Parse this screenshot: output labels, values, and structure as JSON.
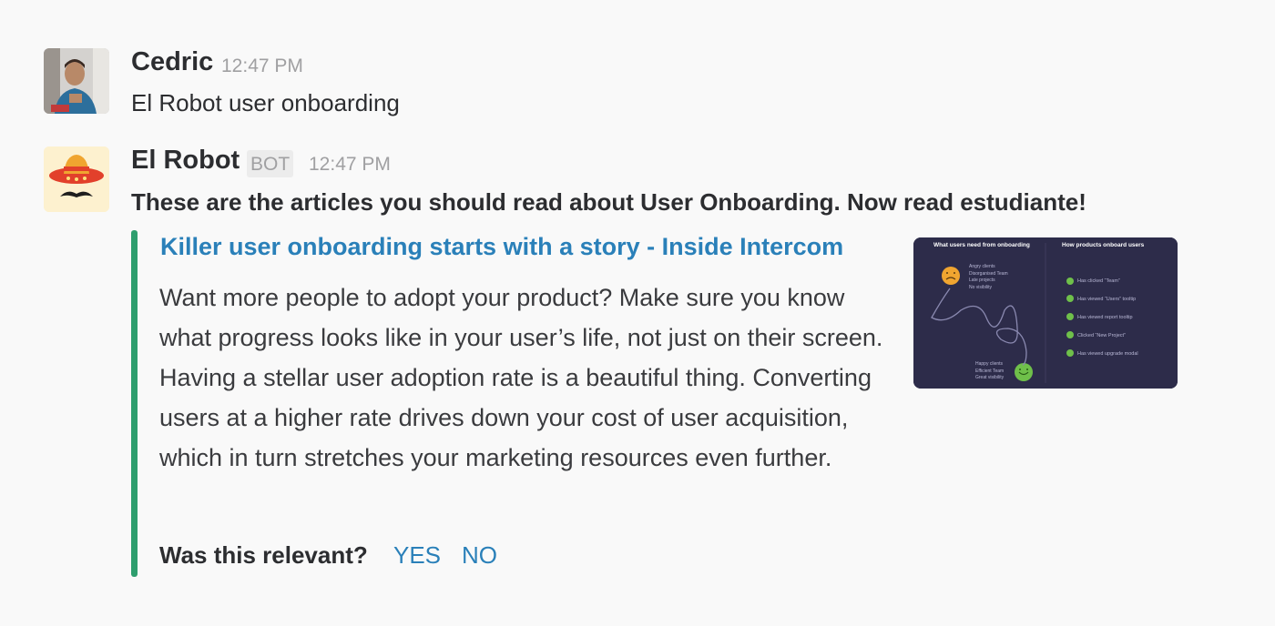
{
  "messages": [
    {
      "author": "Cedric",
      "time": "12:47 PM",
      "text": "El Robot user onboarding",
      "avatar": "user-photo"
    },
    {
      "author": "El Robot",
      "badge": "BOT",
      "time": "12:47 PM",
      "text": "These are the articles you should read about User Onboarding. Now read estudiante!",
      "avatar": "sombrero-mustache-icon",
      "attachment": {
        "accent_color": "#2e9e6e",
        "title": "Killer user onboarding starts with a story - Inside Intercom",
        "body": "Want more people to adopt your product? Make sure you know what progress looks like in your user’s life, not just on their screen. Having a stellar user adoption rate is a beautiful thing. Converting users at a higher rate drives down your cost of user acquisition, which in turn stretches your marketing resources even  further.",
        "thumbnail": {
          "left_heading": "What users need from onboarding",
          "right_heading": "How products onboard users",
          "left_top_items": [
            "Angry clients",
            "Disorganised Team",
            "Late projects",
            "No visibility"
          ],
          "left_bottom_items": [
            "Happy clients",
            "Efficient Team",
            "Great visibility"
          ],
          "right_items": [
            "Has clicked “Team”",
            "Has viewed “Users” tooltip",
            "Has viewed report tooltip",
            "Clicked “New Project”",
            "Has viewed upgrade modal"
          ]
        }
      },
      "prompt": {
        "question": "Was this relevant?",
        "yes": "YES",
        "no": "NO"
      }
    }
  ]
}
